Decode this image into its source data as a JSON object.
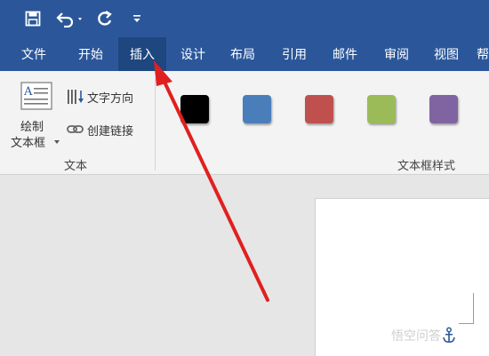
{
  "tabs": [
    {
      "label": "文件"
    },
    {
      "label": "开始"
    },
    {
      "label": "插入"
    },
    {
      "label": "设计"
    },
    {
      "label": "布局"
    },
    {
      "label": "引用"
    },
    {
      "label": "邮件"
    },
    {
      "label": "审阅"
    },
    {
      "label": "视图"
    },
    {
      "label": "帮"
    }
  ],
  "ribbon": {
    "text_group": {
      "draw_textbox_line1": "绘制",
      "draw_textbox_line2": "文本框",
      "text_direction": "文字方向",
      "create_link": "创建链接",
      "group_label": "文本"
    },
    "style_group": {
      "group_label": "文本框样式",
      "swatches": [
        "#000000",
        "#4a7ebb",
        "#c0504d",
        "#9bbb59",
        "#8064a2"
      ]
    }
  },
  "colors": {
    "title_bar": "#2b579a",
    "active_tab": "#1e467f",
    "annotation_arrow": "#e02020"
  },
  "icons": {
    "save": "save-icon",
    "undo": "undo-icon",
    "redo": "redo-icon",
    "customize": "customize-qat-icon",
    "textbox": "textbox-icon",
    "text_direction": "text-direction-icon",
    "link": "link-icon",
    "anchor": "anchor-icon"
  },
  "watermark": "悟空问答"
}
